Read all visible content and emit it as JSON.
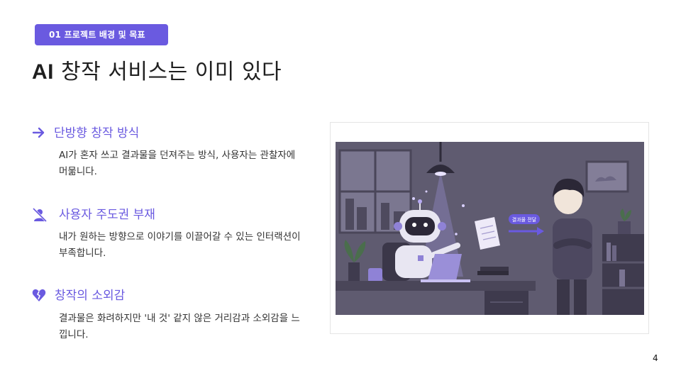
{
  "section_badge": "01 프로젝트 배경 및 목표",
  "title_prefix": "AI",
  "title_rest": " 창작 서비스는 이미 있다",
  "items": [
    {
      "icon": "arrow-right-icon",
      "heading": "단방향 창작 방식",
      "desc": "AI가 혼자 쓰고 결과물을 던져주는 방식, 사용자는 관찰자에 머묾니다."
    },
    {
      "icon": "user-off-icon",
      "heading": "사용자 주도권 부재",
      "desc": "내가 원하는 방향으로 이야기를 이끌어갈 수 있는 인터랙션이 부족합니다."
    },
    {
      "icon": "broken-heart-icon",
      "heading": "창작의 소외감",
      "desc": "결과물은 화려하지만 '내 것' 같지 않은 거리감과 소외감을 느낍니다."
    }
  ],
  "illustration": {
    "arrow_label": "결과물 전달"
  },
  "page_number": "4",
  "colors": {
    "accent": "#6a5ae0",
    "scene_bg": "#5e5a6f"
  }
}
